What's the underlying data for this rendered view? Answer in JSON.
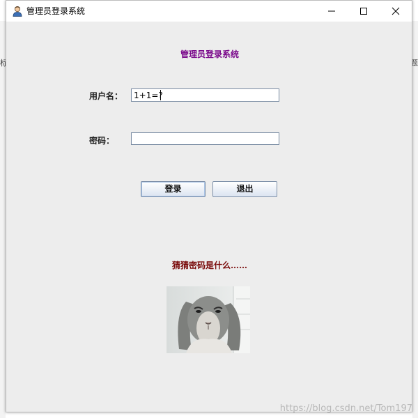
{
  "window": {
    "title": "管理员登录系统",
    "icon": "user-avatar-icon"
  },
  "form": {
    "heading": "管理员登录系统",
    "username_label": "用户名：",
    "username_value": "1+1=?",
    "password_label": "密码：",
    "password_value": ""
  },
  "buttons": {
    "login": "登录",
    "exit": "退出"
  },
  "hint": "猜猜密码是什么……",
  "image": {
    "subject": "rabbit-photo"
  },
  "watermark": "https://blog.csdn.net/Tom197",
  "background_fragments": {
    "left": "标",
    "right": "题"
  },
  "colors": {
    "heading": "#7b0b8c",
    "hint": "#7a0b0b",
    "window_bg": "#ededed",
    "button_gradient_end": "#dbe4f1"
  }
}
